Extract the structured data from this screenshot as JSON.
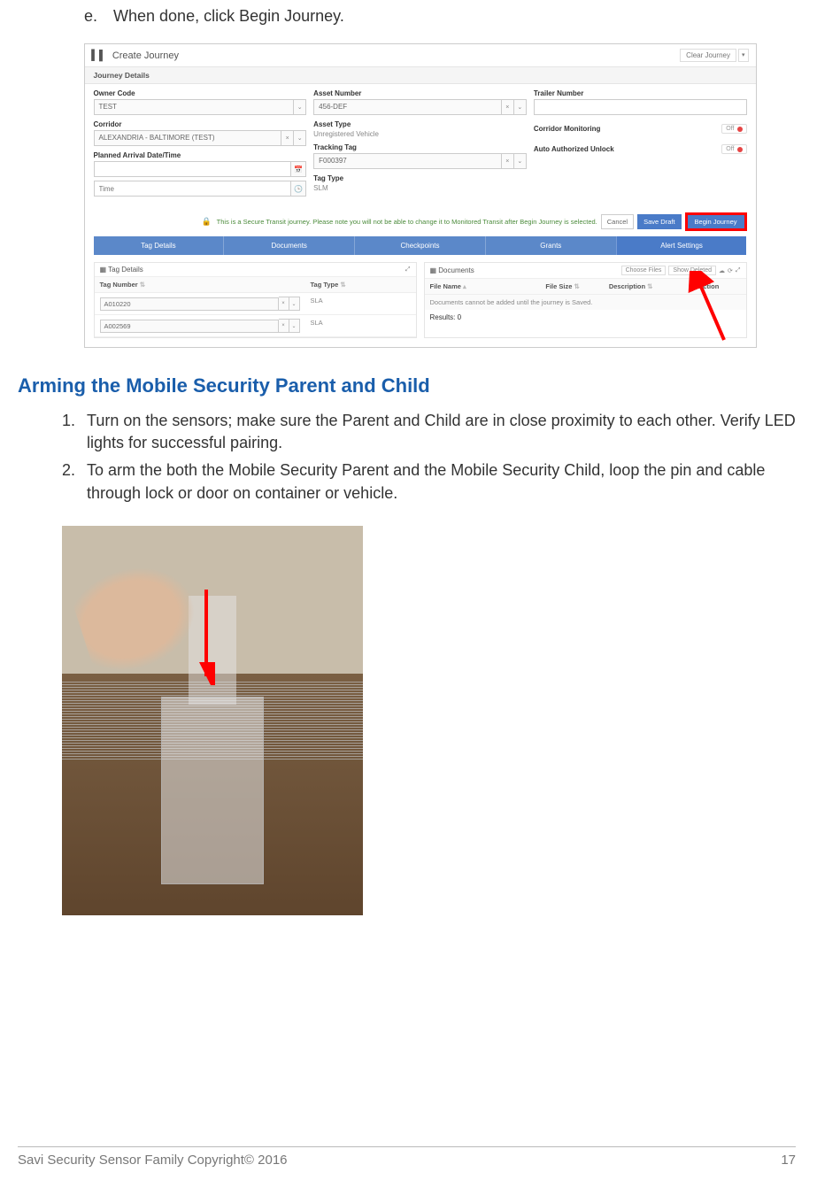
{
  "step_e": {
    "marker": "e.",
    "text": "When done, click Begin Journey."
  },
  "app": {
    "title": "Create Journey",
    "clear_journey": "Clear Journey",
    "details_header": "Journey Details",
    "col1": {
      "owner_code_label": "Owner Code",
      "owner_code_value": "TEST",
      "corridor_label": "Corridor",
      "corridor_value": "ALEXANDRIA - BALTIMORE (TEST)",
      "planned_label": "Planned Arrival Date/Time",
      "planned_value": "",
      "time_placeholder": "Time"
    },
    "col2": {
      "asset_number_label": "Asset Number",
      "asset_number_value": "456-DEF",
      "asset_type_label": "Asset Type",
      "asset_type_value": "Unregistered Vehicle",
      "tracking_tag_label": "Tracking Tag",
      "tracking_tag_value": "F000397",
      "tag_type_label": "Tag Type",
      "tag_type_value": "SLM"
    },
    "col3": {
      "trailer_label": "Trailer Number",
      "corr_mon_label": "Corridor Monitoring",
      "corr_mon_value": "Off",
      "auto_unlock_label": "Auto Authorized Unlock",
      "auto_unlock_value": "Off"
    },
    "notice": "This is a Secure Transit journey. Please note you will not be able to change it to Monitored Transit after Begin Journey is selected.",
    "btn_cancel": "Cancel",
    "btn_save": "Save Draft",
    "btn_begin": "Begin Journey",
    "tabs": [
      "Tag Details",
      "Documents",
      "Checkpoints",
      "Grants",
      "Alert Settings"
    ],
    "tag_panel": {
      "title": "Tag Details",
      "th_tag": "Tag Number",
      "th_type": "Tag Type",
      "rows": [
        {
          "tag": "A010220",
          "type": "SLA"
        },
        {
          "tag": "A002569",
          "type": "SLA"
        }
      ]
    },
    "doc_panel": {
      "title": "Documents",
      "choose": "Choose Files",
      "show_deleted": "Show Deleted",
      "th_name": "File Name",
      "th_size": "File Size",
      "th_desc": "Description",
      "th_action": "Action",
      "empty": "Documents cannot be added until the journey is Saved.",
      "results": "Results: 0"
    }
  },
  "section_title": "Arming the Mobile Security Parent and Child",
  "steps": [
    {
      "marker": "1.",
      "text": "Turn on the sensors; make sure the Parent and Child are in close proximity to each other. Verify LED lights for successful pairing."
    },
    {
      "marker": "2.",
      "text": "To arm the both the Mobile Security Parent and the Mobile Security Child, loop the pin and cable through lock or door on container or vehicle."
    }
  ],
  "footer": {
    "left": "Savi Security Sensor Family Copyright© 2016",
    "right": "17"
  }
}
